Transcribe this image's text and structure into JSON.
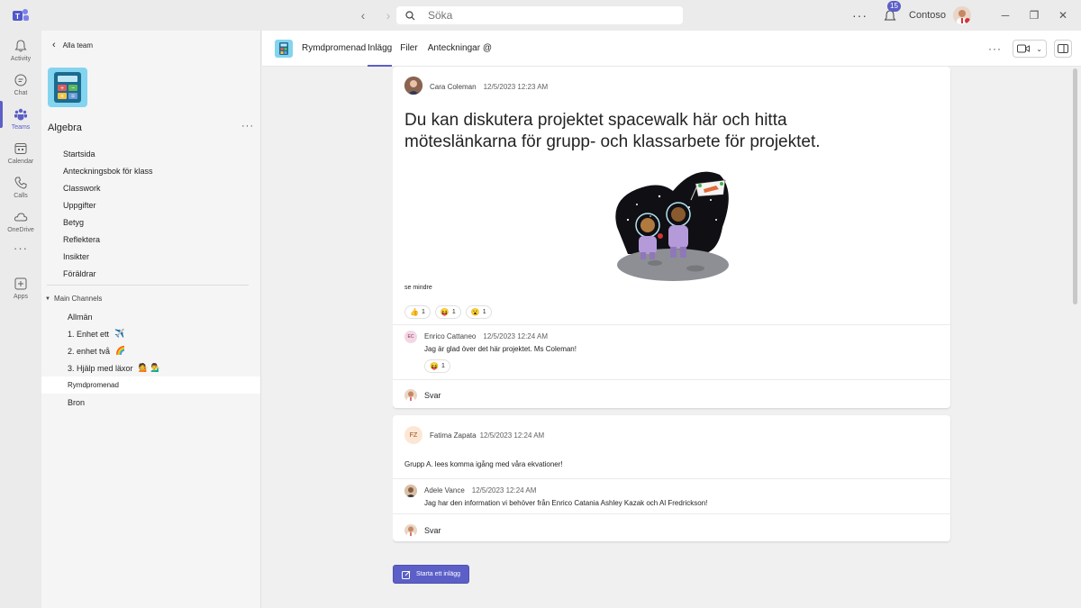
{
  "titlebar": {
    "search_placeholder": "Söka",
    "notification_count": "15",
    "org_name": "Contoso"
  },
  "rail": {
    "items": [
      {
        "label": "Activity",
        "icon": "bell-icon"
      },
      {
        "label": "Chat",
        "icon": "chat-icon"
      },
      {
        "label": "Teams",
        "icon": "teams-icon",
        "active": true
      },
      {
        "label": "Calendar",
        "icon": "calendar-icon"
      },
      {
        "label": "Calls",
        "icon": "phone-icon"
      },
      {
        "label": "OneDrive",
        "icon": "cloud-icon"
      },
      {
        "label": "",
        "icon": "more-icon"
      },
      {
        "label": "Apps",
        "icon": "add-apps-icon"
      }
    ]
  },
  "left": {
    "back_label": "Alla team",
    "team_name": "Algebra",
    "nav": [
      "Startsida",
      "Anteckningsbok för klass",
      "Classwork",
      "Uppgifter",
      "Betyg",
      "Reflektera",
      "Insikter",
      "Föräldrar"
    ],
    "channels_header": "Main Channels",
    "channels": [
      {
        "label": "Allmän",
        "emoji": ""
      },
      {
        "label": "1. Enhet ett",
        "emoji": "✈️"
      },
      {
        "label": "2. enhet två",
        "emoji": "🌈"
      },
      {
        "label": "3. Hjälp med läxor",
        "emoji": "💁 💁‍♂️"
      },
      {
        "label": "Rymdpromenad",
        "emoji": ""
      },
      {
        "label": "Bron",
        "emoji": ""
      }
    ],
    "selected_channel": "Rymdpromenad"
  },
  "channel": {
    "name": "Rymdpromenad",
    "tabs": [
      "Inlägg",
      "Filer",
      "Anteckningar @"
    ]
  },
  "posts": [
    {
      "author": "Cara Coleman",
      "timestamp": "12/5/2023 12:23 AM",
      "body": "Du kan diskutera projektet spacewalk här och hitta möteslänkarna för grupp- och klassarbete för projektet.",
      "see_less": "se mindre",
      "reactions": [
        {
          "emoji": "👍",
          "count": "1"
        },
        {
          "emoji": "😝",
          "count": "1"
        },
        {
          "emoji": "😮",
          "count": "1"
        }
      ],
      "reply": {
        "initials": "EC",
        "author": "Enrico Cattaneo",
        "timestamp": "12/5/2023 12:24 AM",
        "body": "Jag är glad över det här projektet. Ms Coleman!",
        "reaction": {
          "emoji": "😝",
          "count": "1"
        }
      },
      "reply_label": "Svar"
    },
    {
      "initials": "FZ",
      "author": "Fatima Zapata",
      "timestamp": "12/5/2023 12:24 AM",
      "body": "Grupp A. lees komma igång med våra ekvationer!",
      "reply": {
        "author": "Adele Vance",
        "timestamp": "12/5/2023 12:24 AM",
        "body": "Jag har den information vi behöver från Enrico Catania Ashley Kazak och Al Fredrickson!"
      },
      "reply_label": "Svar"
    }
  ],
  "new_post_label": "Starta ett inlägg",
  "colors": {
    "accent": "#5b5fc7",
    "team_tile": "#83d4ef"
  }
}
